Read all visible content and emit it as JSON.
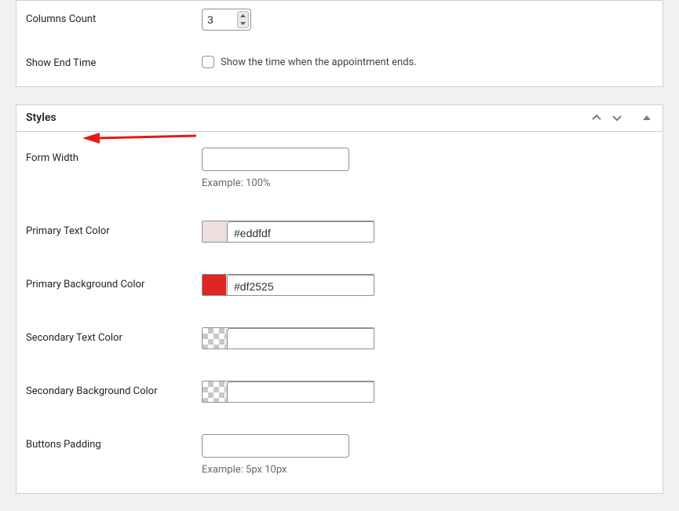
{
  "section_top": {
    "rows": {
      "columns_count": {
        "label": "Columns Count",
        "value": "3"
      },
      "show_end_time": {
        "label": "Show End Time",
        "checkbox_label": "Show the time when the appointment ends.",
        "checked": false
      }
    }
  },
  "section_styles": {
    "title": "Styles",
    "rows": {
      "form_width": {
        "label": "Form Width",
        "value": "",
        "hint": "Example: 100%"
      },
      "primary_text_color": {
        "label": "Primary Text Color",
        "value": "#eddfdf",
        "swatch": "#eddfdf"
      },
      "primary_background_color": {
        "label": "Primary Background Color",
        "value": "#df2525",
        "swatch": "#df2525"
      },
      "secondary_text_color": {
        "label": "Secondary Text Color",
        "value": "",
        "swatch": ""
      },
      "secondary_background_color": {
        "label": "Secondary Background Color",
        "value": "",
        "swatch": ""
      },
      "buttons_padding": {
        "label": "Buttons Padding",
        "value": "",
        "hint": "Example: 5px 10px"
      }
    }
  },
  "colors": {
    "annotation_red": "#e31a1a"
  }
}
